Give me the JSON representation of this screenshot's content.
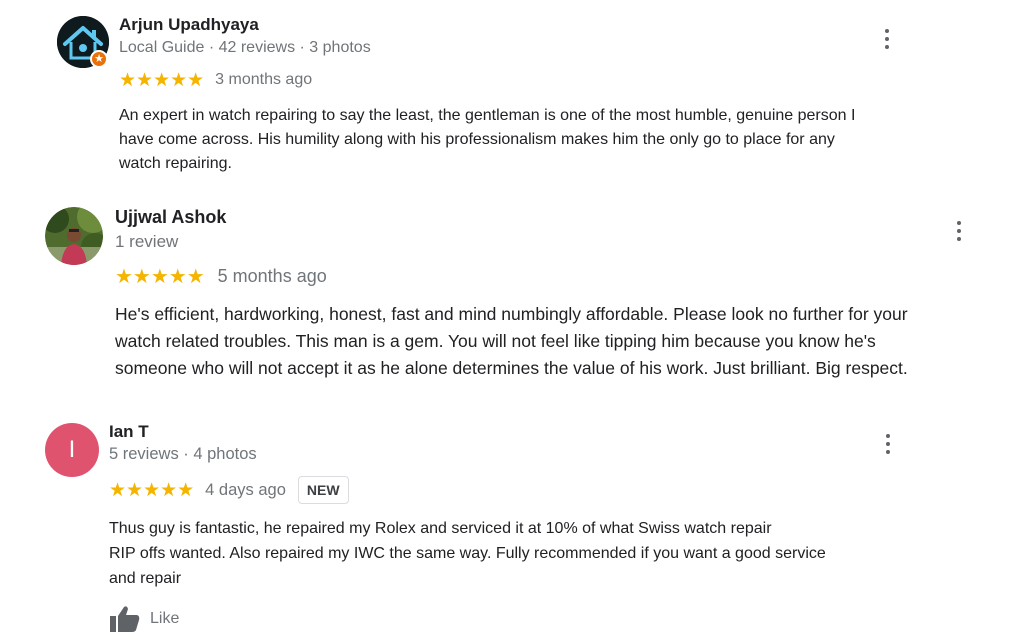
{
  "colors": {
    "star": "#f4b400",
    "meta": "#70757a",
    "ian_avatar": "#e0536f",
    "badge_border": "#dadce0"
  },
  "reviews": [
    {
      "name": "Arjun Upadhyaya",
      "meta": "Local Guide · 42 reviews · 3 photos",
      "rating": 5,
      "stars": "★★★★★",
      "time": "3 months ago",
      "text_lines": [
        "An expert in watch repairing to say the least, the gentleman is one of the most humble, genuine person I",
        "have come across. His humility along with his professionalism makes him the only go to place for any",
        "watch repairing."
      ],
      "avatar_icon": "house-avatar-icon",
      "badge_icon": "local-guide-star-icon"
    },
    {
      "name": "Ujjwal Ashok",
      "meta": "1 review",
      "rating": 5,
      "stars": "★★★★★",
      "time": "5 months ago",
      "text_lines": [
        "He's efficient, hardworking, honest, fast and mind numbingly affordable. Please look no further for your",
        "watch related troubles. This man is a gem. You will not feel like tipping him because you know he's",
        "someone who will not accept it as he alone determines the value of his work. Just brilliant. Big respect."
      ],
      "avatar_icon": "profile-photo"
    },
    {
      "name": "Ian T",
      "meta": "5 reviews · 4 photos",
      "avatar_letter": "I",
      "rating": 5,
      "stars": "★★★★★",
      "time": "4 days ago",
      "badge": "NEW",
      "text_lines": [
        "Thus guy is fantastic, he repaired my Rolex and serviced it at 10% of what Swiss watch repair",
        "RIP offs wanted. Also repaired my IWC the same way. Fully recommended if you want a good service",
        "and repair"
      ],
      "like_label": "Like"
    }
  ]
}
